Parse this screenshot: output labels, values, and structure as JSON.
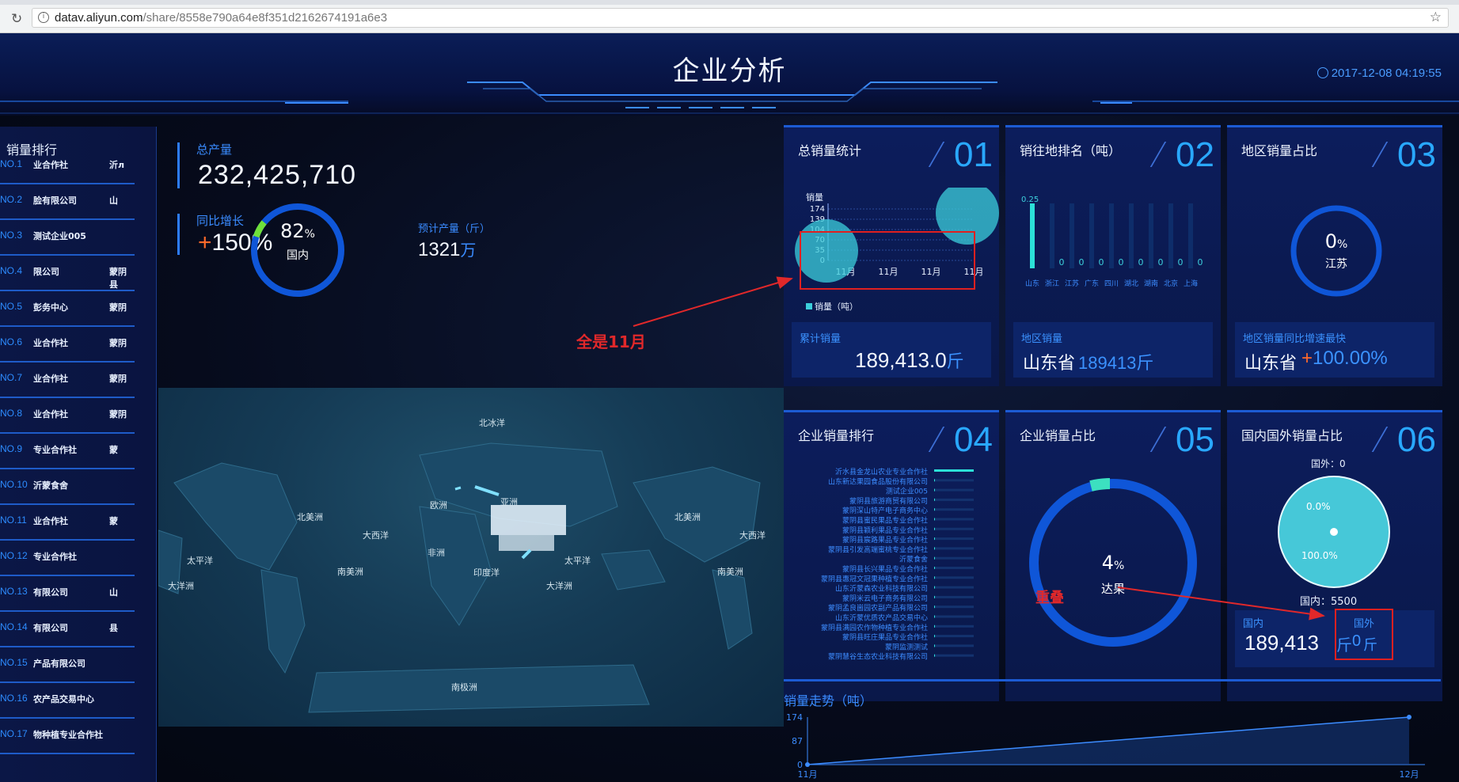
{
  "browser": {
    "url_host": "datav.aliyun.com",
    "url_path": "/share/8558e790a64e8f351d2162674191a6e3"
  },
  "header": {
    "title": "企业分析",
    "datetime": "2017-12-08 04:19:55"
  },
  "ranking": {
    "title": "销量排行",
    "items": [
      {
        "no": "NO.1",
        "name": "业合作社",
        "region": "沂л"
      },
      {
        "no": "NO.2",
        "name": "脸有限公司",
        "region": "山"
      },
      {
        "no": "NO.3",
        "name": "测试企业005",
        "region": ""
      },
      {
        "no": "NO.4",
        "name": "限公司",
        "region": "蒙阴县"
      },
      {
        "no": "NO.5",
        "name": "彭务中心",
        "region": "蒙阴"
      },
      {
        "no": "NO.6",
        "name": "业合作社",
        "region": "蒙阴"
      },
      {
        "no": "NO.7",
        "name": "业合作社",
        "region": "蒙阴"
      },
      {
        "no": "NO.8",
        "name": "业合作社",
        "region": "蒙阴"
      },
      {
        "no": "NO.9",
        "name": "专业合作社",
        "region": "蒙"
      },
      {
        "no": "NO.10",
        "name": "沂蒙食舍",
        "region": ""
      },
      {
        "no": "NO.11",
        "name": "业合作社",
        "region": "蒙"
      },
      {
        "no": "NO.12",
        "name": "专业合作社",
        "region": ""
      },
      {
        "no": "NO.13",
        "name": "有限公司",
        "region": "山"
      },
      {
        "no": "NO.14",
        "name": "有限公司",
        "region": "县"
      },
      {
        "no": "NO.15",
        "name": "产品有限公司",
        "region": ""
      },
      {
        "no": "NO.16",
        "name": "农产品交易中心",
        "region": ""
      },
      {
        "no": "NO.17",
        "name": "物种植专业合作社",
        "region": ""
      }
    ]
  },
  "kpi": {
    "total_label": "总产量",
    "total_value": "232,425,710",
    "growth_label": "同比增长",
    "growth_plus": "+",
    "growth_value": "150%",
    "gauge_value": "82",
    "gauge_unit": "%",
    "gauge_label": "国内",
    "gauge_fraction": 0.82,
    "forecast_label": "预计产量（斤）",
    "forecast_value": "1321",
    "forecast_unit": "万"
  },
  "map": {
    "labels": [
      "北冰洋",
      "北美洲",
      "欧洲",
      "亚洲",
      "北美洲",
      "大西洋",
      "非洲",
      "大西洋",
      "太平洋",
      "太平洋",
      "印度洋",
      "大洋洲",
      "南美洲",
      "大洋洲",
      "南美洲",
      "南极洲"
    ]
  },
  "panels": {
    "p01": {
      "title": "总销量统计",
      "num": "01",
      "chart_data": {
        "type": "bar",
        "ylabel": "销量",
        "yticks": [
          "174",
          "139",
          "104",
          "70",
          "35",
          "0"
        ],
        "categories": [
          "11月",
          "11月",
          "11月",
          "11月"
        ],
        "legend": "销量（吨）"
      },
      "sub_label": "累计销量",
      "sub_value": "189,413.0",
      "sub_unit": "斤"
    },
    "p02": {
      "title": "销往地排名（吨）",
      "num": "02",
      "chart_data": {
        "type": "bar",
        "ymax_label": "0.25",
        "categories": [
          "山东",
          "浙江",
          "江苏",
          "广东",
          "四川",
          "湖北",
          "湖南",
          "北京",
          "上海"
        ],
        "values": [
          0.25,
          0,
          0,
          0,
          0,
          0,
          0,
          0,
          0
        ]
      },
      "sub_label": "地区销量",
      "sub_value_region": "山东省",
      "sub_value": "189413斤"
    },
    "p03": {
      "title": "地区销量占比",
      "num": "03",
      "gauge_value": "0",
      "gauge_unit": "%",
      "gauge_label": "江苏",
      "sub_label": "地区销量同比增速最快",
      "sub_value_region": "山东省",
      "sub_plus": "+",
      "sub_value": "100.00%"
    },
    "p04": {
      "title": "企业销量排行",
      "num": "04",
      "companies": [
        "沂水县金龙山农业专业合作社",
        "山东新达果园食品股份有限公司",
        "测试企业005",
        "蒙阴县旅游商贸有限公司",
        "蒙阴深山特产电子商务中心",
        "蒙阴县蜜民果品专业合作社",
        "蒙阴县颖利果品专业合作社",
        "蒙阴县宸路果品专业合作社",
        "蒙阴县引发高端蜜桃专业合作社",
        "沂蒙食舍",
        "蒙阴县长兴果品专业合作社",
        "蒙阴县惠冠文冠果种植专业合作社",
        "山东沂蒙森农业科技有限公司",
        "蒙阴米云电子商务有限公司",
        "蒙阴孟良崮园农副产品有限公司",
        "山东沂蒙优质农产品交易中心",
        "蒙阴县满园农作物种植专业合作社",
        "蒙阴县旺庄果品专业合作社",
        "蒙阴监测测试",
        "蒙阴慧谷生态农业科技有限公司"
      ],
      "values": [
        1,
        0.02,
        0.01,
        0.01,
        0.01,
        0.01,
        0.01,
        0.01,
        0.01,
        0.01,
        0.01,
        0.01,
        0.01,
        0.01,
        0.01,
        0.01,
        0.01,
        0.01,
        0.01,
        0.01
      ]
    },
    "p05": {
      "title": "企业销量占比",
      "num": "05",
      "gauge_value": "4",
      "gauge_unit": "%",
      "gauge_label": "达果"
    },
    "p06": {
      "title": "国内国外销量占比",
      "num": "06",
      "chart_data": {
        "type": "pie",
        "foreign_label": "国外：0",
        "domestic_label": "国内：5500",
        "foreign_pct": "0.0%",
        "domestic_pct": "100.0%"
      },
      "sub_label_left": "国内",
      "sub_value": "189,413",
      "sub_unit_left": "斤",
      "sub_label_right": "国外",
      "sub_value_right": "0",
      "sub_unit_right": "斤"
    }
  },
  "trend": {
    "title": "销量走势（吨）",
    "chart_data": {
      "type": "area",
      "categories": [
        "11月",
        "12月"
      ],
      "values": [
        0,
        174
      ],
      "yticks": [
        "174",
        "87",
        "0"
      ],
      "ylim": [
        0,
        174
      ]
    }
  },
  "annotations": {
    "all_nov_prefix": "全是",
    "all_nov_value": "11月",
    "overlap": "重叠"
  },
  "colors": {
    "accent": "#2d7cff",
    "cyan": "#3ccfdc",
    "annotation_red": "#e0282a",
    "plus_orange": "#ff6a2a"
  }
}
